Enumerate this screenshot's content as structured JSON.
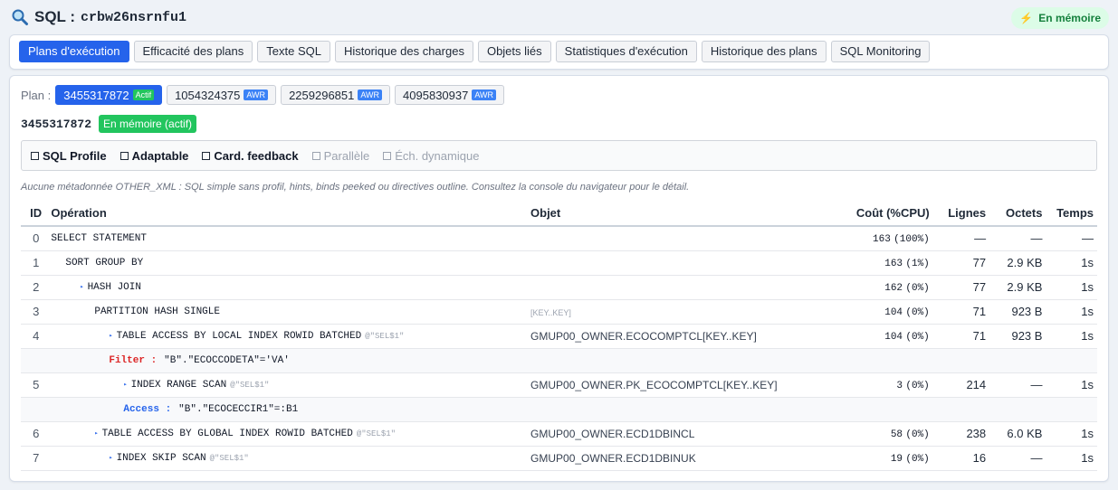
{
  "header": {
    "title_prefix": "SQL :",
    "sql_id": "crbw26nsrnfu1",
    "memory_badge": "En mémoire",
    "colors": {
      "accent": "#2563eb",
      "success": "#22c55e",
      "awr": "#3b82f6"
    }
  },
  "tabs": [
    {
      "label": "Plans d'exécution",
      "active": true
    },
    {
      "label": "Efficacité des plans"
    },
    {
      "label": "Texte SQL"
    },
    {
      "label": "Historique des charges"
    },
    {
      "label": "Objets liés"
    },
    {
      "label": "Statistiques d'exécution"
    },
    {
      "label": "Historique des plans"
    },
    {
      "label": "SQL Monitoring"
    }
  ],
  "plans": {
    "label": "Plan :",
    "items": [
      {
        "hash": "3455317872",
        "tag": "Actif",
        "active": true
      },
      {
        "hash": "1054324375",
        "tag": "AWR"
      },
      {
        "hash": "2259296851",
        "tag": "AWR"
      },
      {
        "hash": "4095830937",
        "tag": "AWR"
      }
    ]
  },
  "selected_plan": {
    "hash": "3455317872",
    "state": "En mémoire (actif)"
  },
  "flags": [
    {
      "label": "SQL Profile",
      "on": true
    },
    {
      "label": "Adaptable",
      "on": true
    },
    {
      "label": "Card. feedback",
      "on": true
    },
    {
      "label": "Parallèle",
      "on": false
    },
    {
      "label": "Éch. dynamique",
      "on": false
    }
  ],
  "note": "Aucune métadonnée OTHER_XML : SQL simple sans profil, hints, binds peeked ou directives outline. Consultez la console du navigateur pour le détail.",
  "table": {
    "headers": {
      "id": "ID",
      "operation": "Opération",
      "object": "Objet",
      "cost": "Coût (%CPU)",
      "rows": "Lignes",
      "bytes": "Octets",
      "time": "Temps"
    },
    "rows": [
      {
        "id": "0",
        "op": "SELECT STATEMENT",
        "tri": "",
        "alias": "",
        "object": "",
        "kk": "",
        "cost": "163",
        "cpu": "(100%)",
        "rows": "—",
        "bytes": "—",
        "time": "—"
      },
      {
        "id": "1",
        "op": "SORT GROUP BY",
        "tri": "",
        "alias": "",
        "object": "",
        "kk": "",
        "cost": "163",
        "cpu": "(1%)",
        "rows": "77",
        "bytes": "2.9 KB",
        "time": "1s"
      },
      {
        "id": "2",
        "op": "HASH JOIN",
        "tri": "▸",
        "alias": "",
        "object": "",
        "kk": "",
        "cost": "162",
        "cpu": "(0%)",
        "rows": "77",
        "bytes": "2.9 KB",
        "time": "1s"
      },
      {
        "id": "3",
        "op": "PARTITION HASH SINGLE",
        "tri": "",
        "alias": "",
        "object": "",
        "kk": "[KEY..KEY]",
        "cost": "104",
        "cpu": "(0%)",
        "rows": "71",
        "bytes": "923 B",
        "time": "1s"
      },
      {
        "id": "4",
        "op": "TABLE ACCESS BY LOCAL INDEX ROWID BATCHED",
        "tri": "▸",
        "alias": "@\"SEL$1\"",
        "object": "GMUP00_OWNER.ECOCOMPTCL",
        "kk": "[KEY..KEY]",
        "cost": "104",
        "cpu": "(0%)",
        "rows": "71",
        "bytes": "923 B",
        "time": "1s"
      },
      {
        "id": "5",
        "op": "INDEX RANGE SCAN",
        "tri": "▸",
        "alias": "@\"SEL$1\"",
        "object": "GMUP00_OWNER.PK_ECOCOMPTCL",
        "kk": "[KEY..KEY]",
        "cost": "3",
        "cpu": "(0%)",
        "rows": "214",
        "bytes": "—",
        "time": "1s"
      },
      {
        "id": "6",
        "op": "TABLE ACCESS BY GLOBAL INDEX ROWID BATCHED",
        "tri": "▸",
        "alias": "@\"SEL$1\"",
        "object": "GMUP00_OWNER.ECD1DBINCL",
        "kk": "",
        "cost": "58",
        "cpu": "(0%)",
        "rows": "238",
        "bytes": "6.0 KB",
        "time": "1s"
      },
      {
        "id": "7",
        "op": "INDEX SKIP SCAN",
        "tri": "▸",
        "alias": "@\"SEL$1\"",
        "object": "GMUP00_OWNER.ECD1DBINUK",
        "kk": "",
        "cost": "19",
        "cpu": "(0%)",
        "rows": "16",
        "bytes": "—",
        "time": "1s"
      }
    ],
    "predicates": {
      "filter4": {
        "key": "Filter :",
        "text": "\"B\".\"ECOCCODETA\"='VA'"
      },
      "access5": {
        "key": "Access :",
        "text": "\"B\".\"ECOCECCIR1\"=:B1"
      }
    }
  }
}
